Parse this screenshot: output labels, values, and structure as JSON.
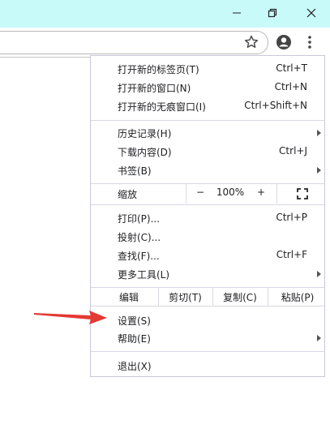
{
  "window": {
    "minimize_icon": "minimize-icon",
    "restore_icon": "restore-icon",
    "close_icon": "close-icon"
  },
  "toolbar": {
    "bookmark_icon": "star-icon",
    "profile_icon": "avatar-icon",
    "menu_icon": "kebab-icon"
  },
  "menu": {
    "new_tab": {
      "label": "打开新的标签页(T)",
      "shortcut": "Ctrl+T"
    },
    "new_window": {
      "label": "打开新的窗口(N)",
      "shortcut": "Ctrl+N"
    },
    "new_incognito": {
      "label": "打开新的无痕窗口(I)",
      "shortcut": "Ctrl+Shift+N"
    },
    "history": {
      "label": "历史记录(H)"
    },
    "downloads": {
      "label": "下载内容(D)",
      "shortcut": "Ctrl+J"
    },
    "bookmarks": {
      "label": "书签(B)"
    },
    "zoom": {
      "label": "缩放",
      "minus": "−",
      "value": "100%",
      "plus": "+"
    },
    "print": {
      "label": "打印(P)...",
      "shortcut": "Ctrl+P"
    },
    "cast": {
      "label": "投射(C)..."
    },
    "find": {
      "label": "查找(F)...",
      "shortcut": "Ctrl+F"
    },
    "more_tools": {
      "label": "更多工具(L)"
    },
    "edit": {
      "label": "编辑",
      "cut": "剪切(T)",
      "copy": "复制(C)",
      "paste": "粘贴(P)"
    },
    "settings": {
      "label": "设置(S)"
    },
    "help": {
      "label": "帮助(E)"
    },
    "exit": {
      "label": "退出(X)"
    }
  },
  "annotation": {
    "arrow_color": "#e53935"
  }
}
